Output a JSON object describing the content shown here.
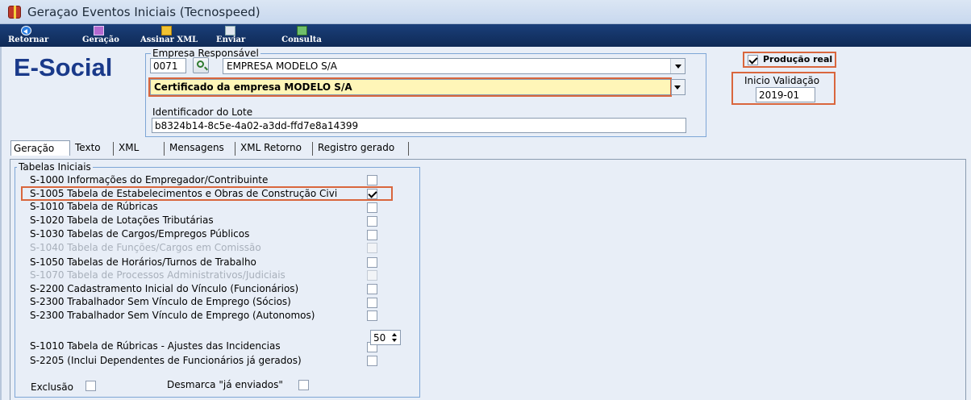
{
  "window": {
    "title": "Geraçao Eventos Iniciais (Tecnospeed)"
  },
  "toolbar": {
    "buttons": [
      {
        "label": "Retornar",
        "icon": "back-arrow-icon"
      },
      {
        "label": "Geração",
        "icon": "generate-icon"
      },
      {
        "label": "Assinar XML",
        "icon": "sign-folder-icon"
      },
      {
        "label": "Enviar",
        "icon": "send-icon"
      },
      {
        "label": "Consulta",
        "icon": "consult-icon"
      }
    ]
  },
  "logo": {
    "text": "E-Social"
  },
  "empresa": {
    "group_label": "Empresa Responsável",
    "code": "0071",
    "name": "EMPRESA MODELO S/A",
    "certificate": "Certificado da empresa MODELO S/A",
    "lote_label": "Identificador do Lote",
    "lote_value": "b8324b14-8c5e-4a02-a3dd-ffd7e8a14399"
  },
  "producao": {
    "label": "Produção real",
    "checked": true
  },
  "validacao": {
    "label": "Inicio Validação",
    "value": "2019-01"
  },
  "tabs": [
    {
      "label": "Geração",
      "active": true
    },
    {
      "label": "Texto"
    },
    {
      "label": "XML"
    },
    {
      "label": "Mensagens"
    },
    {
      "label": "XML Retorno"
    },
    {
      "label": "Registro gerado"
    }
  ],
  "tabelas": {
    "group_label": "Tabelas Iniciais",
    "items": [
      {
        "label": "S-1000 Informações do Empregador/Contribuinte",
        "checked": false,
        "enabled": true
      },
      {
        "label": "S-1005 Tabela de Estabelecimentos e Obras de Construção Civi",
        "checked": true,
        "enabled": true
      },
      {
        "label": "S-1010 Tabela de Rúbricas",
        "checked": false,
        "enabled": true
      },
      {
        "label": "S-1020 Tabela de Lotações Tributárias",
        "checked": false,
        "enabled": true
      },
      {
        "label": "S-1030 Tabelas de Cargos/Empregos Públicos",
        "checked": false,
        "enabled": true
      },
      {
        "label": "S-1040 Tabela de Funções/Cargos em Comissão",
        "checked": false,
        "enabled": false
      },
      {
        "label": "S-1050 Tabelas de Horários/Turnos de Trabalho",
        "checked": false,
        "enabled": true
      },
      {
        "label": "S-1070 Tabela de Processos Administrativos/Judiciais",
        "checked": false,
        "enabled": false
      },
      {
        "label": "S-2200 Cadastramento Inicial do Vínculo (Funcionários)",
        "checked": false,
        "enabled": true
      },
      {
        "label": "S-2300 Trabalhador Sem Vínculo de Emprego (Sócios)",
        "checked": false,
        "enabled": true
      },
      {
        "label": "S-2300 Trabalhador Sem Vínculo de Emprego (Autonomos)",
        "checked": false,
        "enabled": true
      }
    ],
    "extra_items": [
      {
        "label": "S-1010 Tabela de Rúbricas - Ajustes das Incidencias",
        "checked": false
      },
      {
        "label": "S-2205 (Inclui Dependentes de Funcionários já gerados)",
        "checked": false
      }
    ]
  },
  "footer": {
    "exclusao_label": "Exclusão",
    "desmarca_label": "Desmarca \"já enviados\"",
    "spin_value": "50"
  },
  "colors": {
    "highlight": "#d9663d",
    "toolbar": "#1a3f7a",
    "logo": "#1a3a8a",
    "certificate_bg": "#fff6b8"
  }
}
